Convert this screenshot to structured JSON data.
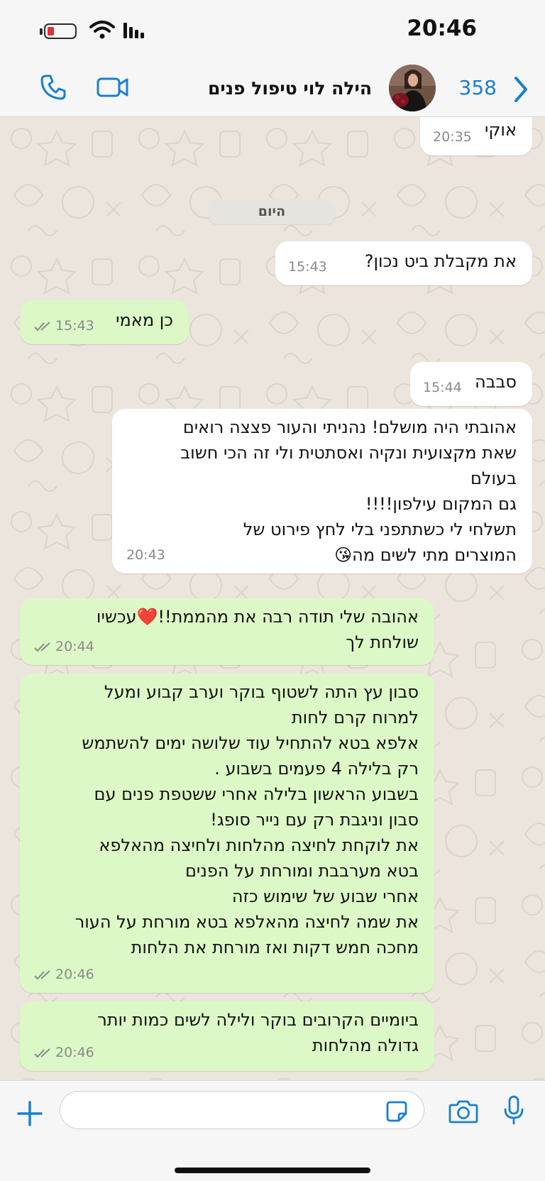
{
  "status_bar": {
    "time": "20:46",
    "battery_level": 0.25,
    "battery_color": "#e0303a"
  },
  "header": {
    "back_count": "358",
    "contact_name": "הילה לוי טיפול פנים",
    "accent_color": "#1a7fd0",
    "icons": [
      "chevron-left-icon",
      "video-icon",
      "phone-icon"
    ]
  },
  "day_separator": "היום",
  "messages": [
    {
      "direction": "in",
      "text": "אוקי",
      "time": "20:35"
    },
    {
      "direction": "in",
      "text": "את מקבלת ביט נכון?",
      "time": "15:43"
    },
    {
      "direction": "out",
      "text": "כן מאמי",
      "time": "15:43",
      "read": true
    },
    {
      "direction": "in",
      "text": "סבבה",
      "time": "15:44"
    },
    {
      "direction": "in",
      "text": "אהובתי היה מושלם! נהניתי והעור פצצה רואים\nשאת מקצועית ונקיה ואסתטית ולי זה הכי חשוב\nבעולם\nגם המקום עילפון!!!!\nתשלחי לי כשתתפני בלי לחץ פירוט של\nהמוצרים מתי לשים מה😘",
      "time": "20:43"
    },
    {
      "direction": "out",
      "text": "אהובה שלי תודה רבה את מהממת!!❤️עכשיו\nשולחת לך",
      "time": "20:44",
      "read": true
    },
    {
      "direction": "out",
      "text": "סבון עץ התה לשטוף בוקר וערב קבוע ומעל\nלמרוח קרם לחות\nאלפא בטא להתחיל עוד שלושה ימים להשתמש\nרק בלילה 4 פעמים בשבוע .\nבשבוע הראשון בלילה אחרי ששטפת פנים עם\nסבון וניגבת רק עם נייר סופג!\nאת לוקחת לחיצה מהלחות ולחיצה מהאלפא\nבטא מערבבת ומורחת על הפנים\nאחרי שבוע של שימוש כזה\nאת שמה לחיצה מהאלפא בטא מורחת על העור\nמחכה חמש דקות ואז מורחת את הלחות",
      "time": "20:46",
      "read": true
    },
    {
      "direction": "out",
      "text": "ביומיים הקרובים בוקר ולילה לשים כמות יותר\nגדולה מהלחות",
      "time": "20:46",
      "read": true
    }
  ],
  "composer": {
    "placeholder": "",
    "icons": [
      "plus-icon",
      "sticker-icon",
      "camera-icon",
      "microphone-icon"
    ]
  },
  "colors": {
    "incoming_bubble": "#ffffff",
    "outgoing_bubble": "#dcf8c6",
    "chat_background": "#ece5dd",
    "read_ticks": "#8a8a8a"
  }
}
